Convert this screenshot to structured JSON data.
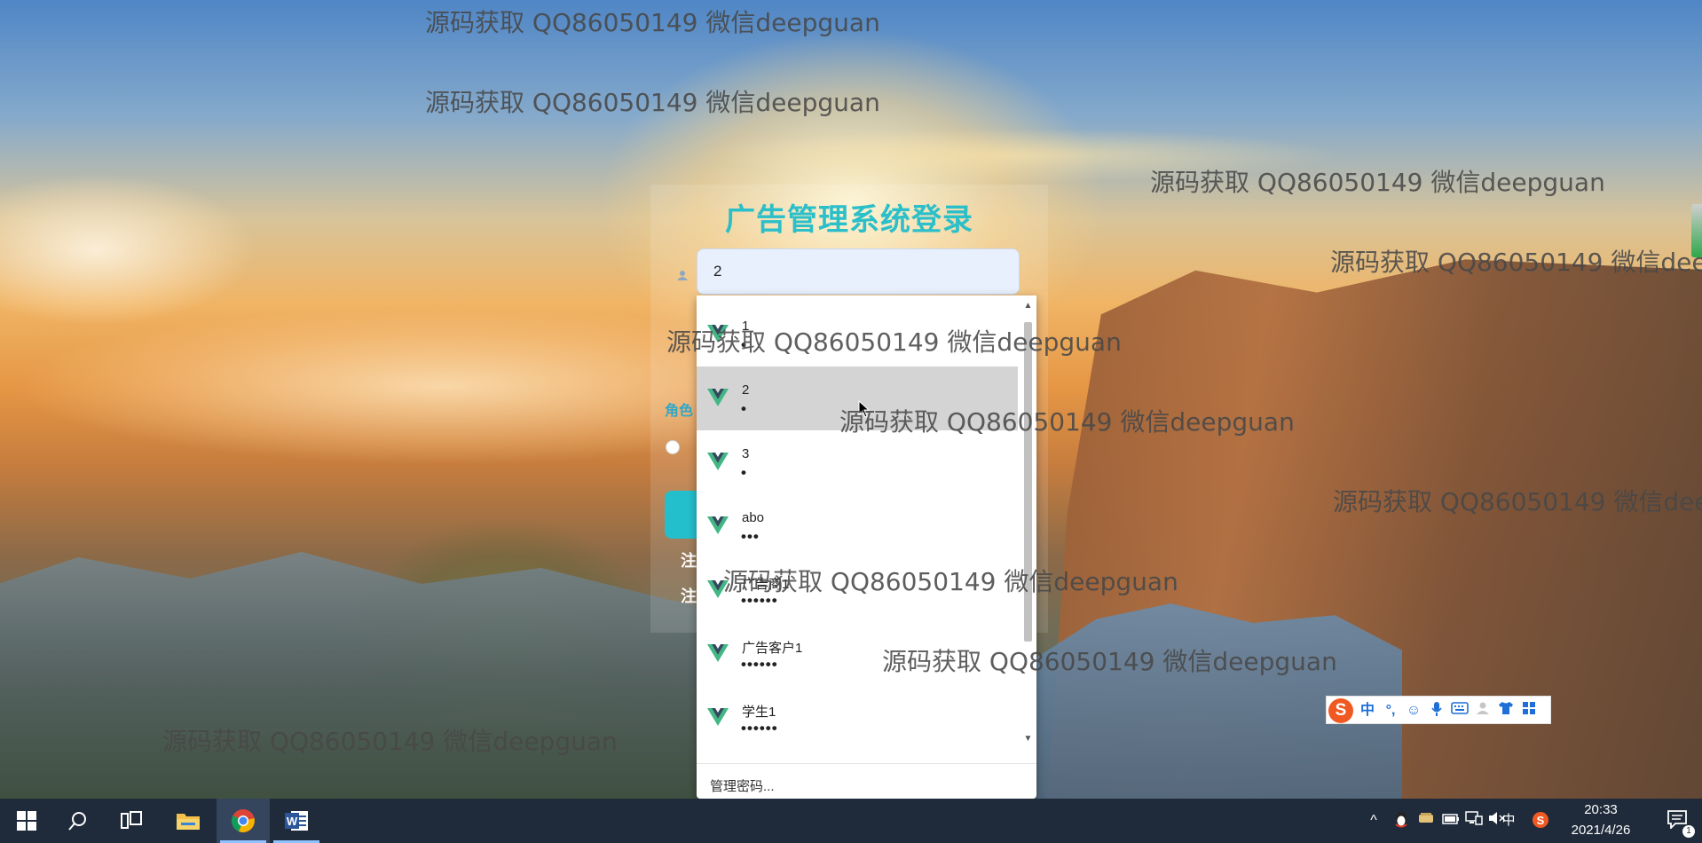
{
  "login": {
    "title": "广告管理系统登录",
    "username_value": "2",
    "role_label": "角色",
    "register_edge_1": "注",
    "register_edge_2": "注"
  },
  "autocomplete": {
    "items": [
      {
        "username": "1",
        "password_mask": "•"
      },
      {
        "username": "2",
        "password_mask": "•",
        "selected": true
      },
      {
        "username": "3",
        "password_mask": "•"
      },
      {
        "username": "abo",
        "password_mask": "•••"
      },
      {
        "username": "广告商1",
        "password_mask": "••••••"
      },
      {
        "username": "广告客户1",
        "password_mask": "••••••"
      },
      {
        "username": "学生1",
        "password_mask": "••••••"
      }
    ],
    "manage_passwords": "管理密码..."
  },
  "watermark": {
    "text": "源码获取 QQ86050149 微信deepguan"
  },
  "ime": {
    "logo": "S",
    "mode": "中",
    "punct": "°,",
    "emoji": "☺",
    "voice": "🎤",
    "keyboard": "⌨",
    "skin": "👕",
    "tools": "▦"
  },
  "taskbar": {
    "apps": [
      {
        "name": "start",
        "icon": "windows-logo"
      },
      {
        "name": "search",
        "icon": "search-icon"
      },
      {
        "name": "task-view",
        "icon": "task-view-icon"
      },
      {
        "name": "file-explorer",
        "icon": "folder-icon"
      },
      {
        "name": "chrome",
        "icon": "chrome-icon"
      },
      {
        "name": "word",
        "icon": "word-icon"
      }
    ],
    "tray": {
      "ime_mode": "中",
      "time": "20:33",
      "date": "2021/4/26",
      "notification_count": "1"
    }
  },
  "colors": {
    "title": "#2bbfc9",
    "input_bg": "#e8f0fe",
    "selected_row": "#d4d4d4",
    "taskbar": "#1f2a3a",
    "vue_green": "#41b883",
    "vue_dark": "#34495e"
  }
}
